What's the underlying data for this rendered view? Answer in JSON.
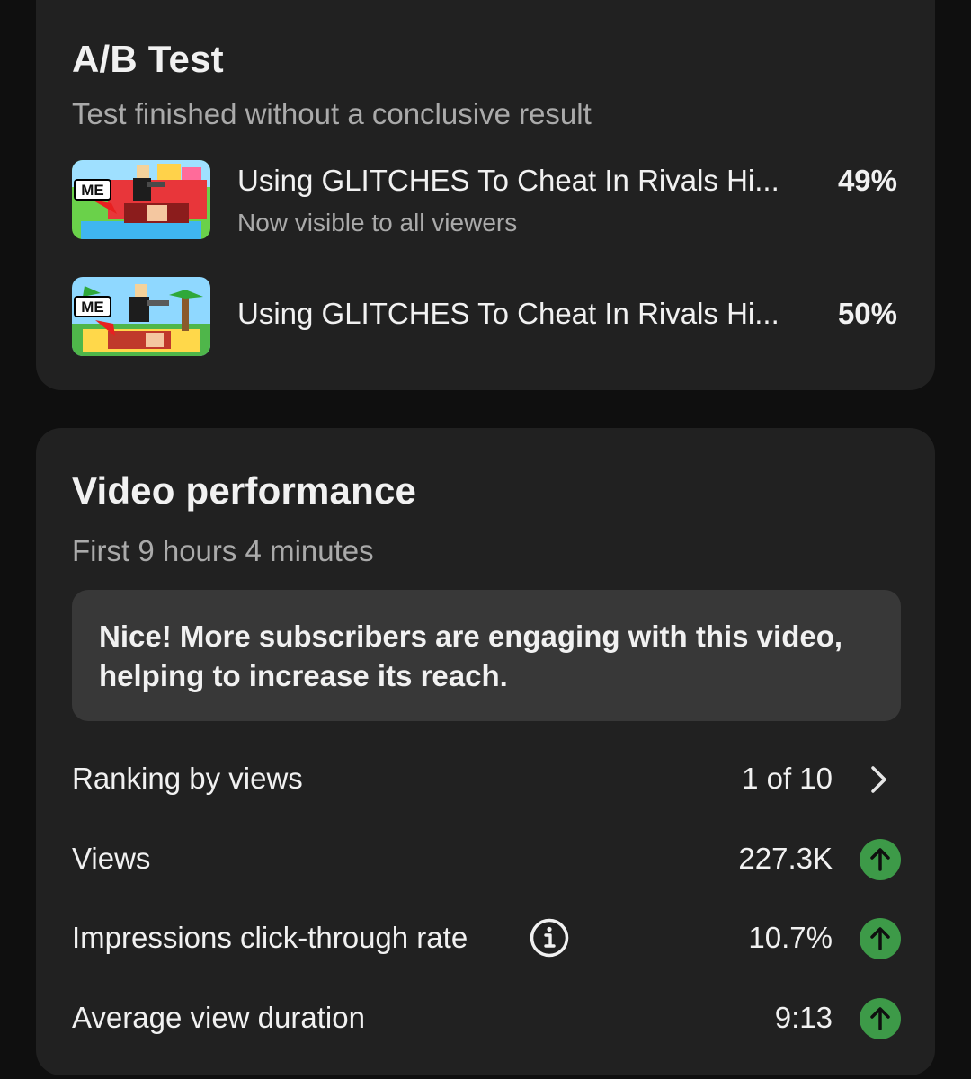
{
  "ab_test": {
    "title": "A/B Test",
    "subtitle": "Test finished without a conclusive result",
    "variants": [
      {
        "thumbnail_label": "ME",
        "title": "Using GLITCHES To Cheat In Rivals Hi...",
        "status": "Now visible to all viewers",
        "percent": "49%"
      },
      {
        "thumbnail_label": "ME",
        "title": "Using GLITCHES To Cheat In Rivals Hi...",
        "percent": "50%"
      }
    ]
  },
  "performance": {
    "title": "Video performance",
    "subtitle": "First 9 hours 4 minutes",
    "notice": "Nice! More subscribers are engaging with this video, helping to increase its reach.",
    "metrics": [
      {
        "label": "Ranking by views",
        "value": "1 of 10",
        "icon": "chevron-right-icon"
      },
      {
        "label": "Views",
        "value": "227.3K",
        "icon": "trend-up-icon"
      },
      {
        "label": "Impressions click-through rate",
        "value": "10.7%",
        "icon": "trend-up-icon",
        "info_icon": "info-icon"
      },
      {
        "label": "Average view duration",
        "value": "9:13",
        "icon": "trend-up-icon"
      }
    ]
  },
  "colors": {
    "background": "#0f0f0f",
    "card": "#212121",
    "notice": "#383838",
    "secondary_text": "#aaaaaa",
    "trend_up": "#3d9a48"
  }
}
